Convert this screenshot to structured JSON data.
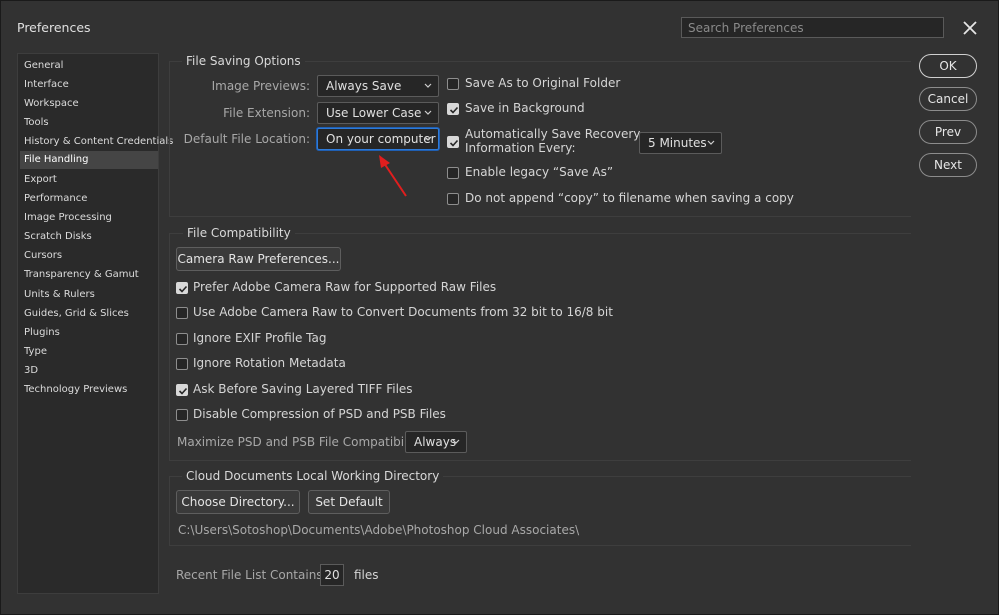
{
  "window": {
    "title": "Preferences"
  },
  "search": {
    "placeholder": "Search Preferences"
  },
  "sidebar": {
    "items": [
      {
        "label": "General",
        "active": false
      },
      {
        "label": "Interface",
        "active": false
      },
      {
        "label": "Workspace",
        "active": false
      },
      {
        "label": "Tools",
        "active": false
      },
      {
        "label": "History & Content Credentials",
        "active": false
      },
      {
        "label": "File Handling",
        "active": true
      },
      {
        "label": "Export",
        "active": false
      },
      {
        "label": "Performance",
        "active": false
      },
      {
        "label": "Image Processing",
        "active": false
      },
      {
        "label": "Scratch Disks",
        "active": false
      },
      {
        "label": "Cursors",
        "active": false
      },
      {
        "label": "Transparency & Gamut",
        "active": false
      },
      {
        "label": "Units & Rulers",
        "active": false
      },
      {
        "label": "Guides, Grid & Slices",
        "active": false
      },
      {
        "label": "Plugins",
        "active": false
      },
      {
        "label": "Type",
        "active": false
      },
      {
        "label": "3D",
        "active": false
      },
      {
        "label": "Technology Previews",
        "active": false
      }
    ]
  },
  "file_saving": {
    "title": "File Saving Options",
    "image_previews_label": "Image Previews:",
    "image_previews_value": "Always Save",
    "file_extension_label": "File Extension:",
    "file_extension_value": "Use Lower Case",
    "default_location_label": "Default File Location:",
    "default_location_value": "On your computer",
    "save_as_original": {
      "label": "Save As to Original Folder",
      "checked": false
    },
    "save_in_background": {
      "label": "Save in Background",
      "checked": true
    },
    "auto_save": {
      "label_line1": "Automatically Save Recovery",
      "label_line2": "Information Every:",
      "checked": true
    },
    "auto_save_interval": "5 Minutes",
    "legacy_save_as": {
      "label": "Enable legacy “Save As”",
      "checked": false
    },
    "no_append_copy": {
      "label": "Do not append “copy” to filename when saving a copy",
      "checked": false
    }
  },
  "compatibility": {
    "title": "File Compatibility",
    "camera_raw_button": "Camera Raw Preferences...",
    "options": [
      {
        "label": "Prefer Adobe Camera Raw for Supported Raw Files",
        "checked": true
      },
      {
        "label": "Use Adobe Camera Raw to Convert Documents from 32 bit to 16/8 bit",
        "checked": false
      },
      {
        "label": "Ignore EXIF Profile Tag",
        "checked": false
      },
      {
        "label": "Ignore Rotation Metadata",
        "checked": false
      },
      {
        "label": "Ask Before Saving Layered TIFF Files",
        "checked": true
      },
      {
        "label": "Disable Compression of PSD and PSB Files",
        "checked": false
      }
    ],
    "maximize_label": "Maximize PSD and PSB File Compatibility:",
    "maximize_value": "Always"
  },
  "cloud": {
    "title": "Cloud Documents Local Working Directory",
    "choose_button": "Choose Directory...",
    "default_button": "Set Default",
    "path": "C:\\Users\\Sotoshop\\Documents\\Adobe\\Photoshop Cloud Associates\\"
  },
  "recent": {
    "label": "Recent File List Contains:",
    "value": "20",
    "suffix": "files"
  },
  "buttons": {
    "ok": "OK",
    "cancel": "Cancel",
    "prev": "Prev",
    "next": "Next"
  },
  "colors": {
    "focus_border": "#2f7bd8",
    "arrow": "#e01e1e",
    "active_item": "#454545"
  }
}
